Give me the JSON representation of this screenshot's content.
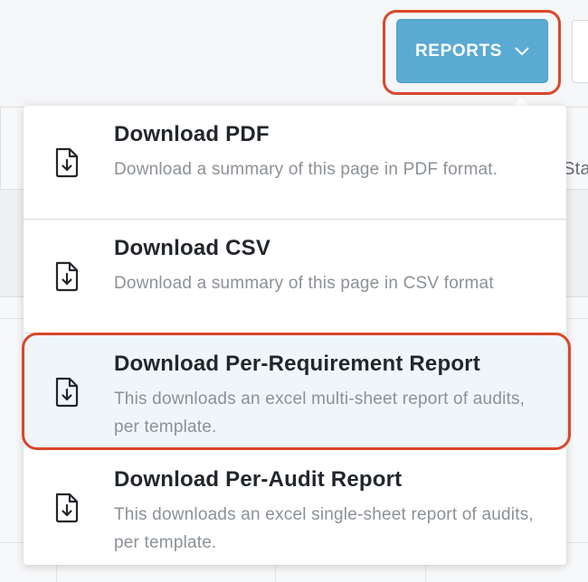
{
  "toolbar": {
    "reports_label": "REPORTS",
    "reports_icon": "chevron-down-icon"
  },
  "background": {
    "partial_column_label": "Statu"
  },
  "reports_menu": {
    "items": [
      {
        "title": "Download PDF",
        "description": "Download a summary of this page in PDF format.",
        "icon": "file-download-icon"
      },
      {
        "title": "Download CSV",
        "description": "Download a summary of this page in CSV format",
        "icon": "file-download-icon"
      },
      {
        "title": "Download Per-Requirement Report",
        "description": "This downloads an excel multi-sheet report of audits, per template.",
        "icon": "file-download-icon"
      },
      {
        "title": "Download Per-Audit Report",
        "description": "This downloads an excel single-sheet report of audits, per template.",
        "icon": "file-download-icon"
      }
    ]
  },
  "colors": {
    "accent": "#5aaad3",
    "highlight_outline": "#d9472b",
    "hover_background": "#eef6f9"
  }
}
